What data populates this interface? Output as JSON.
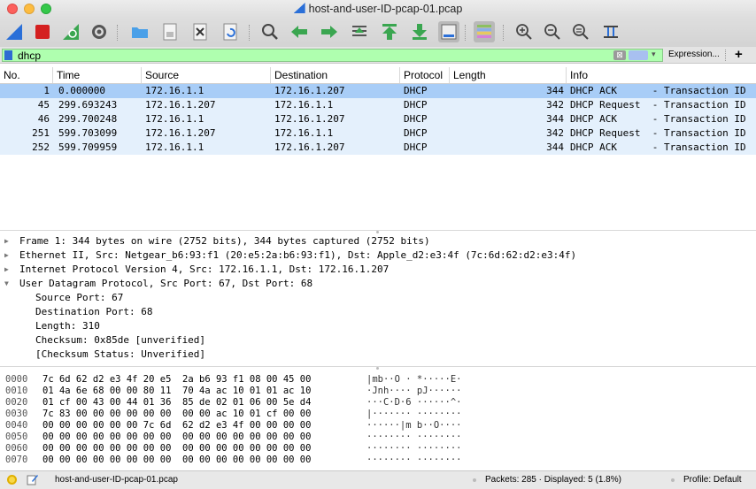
{
  "window": {
    "title": "host-and-user-ID-pcap-01.pcap"
  },
  "filter": {
    "value": "dhcp",
    "expression_label": "Expression...",
    "plus_label": "+",
    "clear_label": "⊠"
  },
  "columns": [
    "No.",
    "Time",
    "Source",
    "Destination",
    "Protocol",
    "Length",
    "Info"
  ],
  "packets": [
    {
      "no": "1",
      "time": "0.000000",
      "src": "172.16.1.1",
      "dst": "172.16.1.207",
      "proto": "DHCP",
      "len": "344",
      "info": "DHCP ACK      - Transaction ID"
    },
    {
      "no": "45",
      "time": "299.693243",
      "src": "172.16.1.207",
      "dst": "172.16.1.1",
      "proto": "DHCP",
      "len": "342",
      "info": "DHCP Request  - Transaction ID"
    },
    {
      "no": "46",
      "time": "299.700248",
      "src": "172.16.1.1",
      "dst": "172.16.1.207",
      "proto": "DHCP",
      "len": "344",
      "info": "DHCP ACK      - Transaction ID"
    },
    {
      "no": "251",
      "time": "599.703099",
      "src": "172.16.1.207",
      "dst": "172.16.1.1",
      "proto": "DHCP",
      "len": "342",
      "info": "DHCP Request  - Transaction ID"
    },
    {
      "no": "252",
      "time": "599.709959",
      "src": "172.16.1.1",
      "dst": "172.16.1.207",
      "proto": "DHCP",
      "len": "344",
      "info": "DHCP ACK      - Transaction ID"
    }
  ],
  "details": [
    {
      "text": "Frame 1: 344 bytes on wire (2752 bits), 344 bytes captured (2752 bits)",
      "expanded": false
    },
    {
      "text": "Ethernet II, Src: Netgear_b6:93:f1 (20:e5:2a:b6:93:f1), Dst: Apple_d2:e3:4f (7c:6d:62:d2:e3:4f)",
      "expanded": false
    },
    {
      "text": "Internet Protocol Version 4, Src: 172.16.1.1, Dst: 172.16.1.207",
      "expanded": false
    },
    {
      "text": "User Datagram Protocol, Src Port: 67, Dst Port: 68",
      "expanded": true
    },
    {
      "text": "Source Port: 67",
      "child": true
    },
    {
      "text": "Destination Port: 68",
      "child": true
    },
    {
      "text": "Length: 310",
      "child": true
    },
    {
      "text": "Checksum: 0x85de [unverified]",
      "child": true
    },
    {
      "text": "[Checksum Status: Unverified]",
      "child": true
    }
  ],
  "hex": [
    {
      "off": "0000",
      "bytes": "7c 6d 62 d2 e3 4f 20 e5  2a b6 93 f1 08 00 45 00",
      "ascii": "|mb··O · *·····E·"
    },
    {
      "off": "0010",
      "bytes": "01 4a 6e 68 00 00 80 11  70 4a ac 10 01 01 ac 10",
      "ascii": "·Jnh···· pJ······"
    },
    {
      "off": "0020",
      "bytes": "01 cf 00 43 00 44 01 36  85 de 02 01 06 00 5e d4",
      "ascii": "···C·D·6 ······^·"
    },
    {
      "off": "0030",
      "bytes": "7c 83 00 00 00 00 00 00  00 00 ac 10 01 cf 00 00",
      "ascii": "|······· ········"
    },
    {
      "off": "0040",
      "bytes": "00 00 00 00 00 00 7c 6d  62 d2 e3 4f 00 00 00 00",
      "ascii": "······|m b··O····"
    },
    {
      "off": "0050",
      "bytes": "00 00 00 00 00 00 00 00  00 00 00 00 00 00 00 00",
      "ascii": "········ ········"
    },
    {
      "off": "0060",
      "bytes": "00 00 00 00 00 00 00 00  00 00 00 00 00 00 00 00",
      "ascii": "········ ········"
    },
    {
      "off": "0070",
      "bytes": "00 00 00 00 00 00 00 00  00 00 00 00 00 00 00 00",
      "ascii": "········ ········"
    }
  ],
  "status": {
    "file": "host-and-user-ID-pcap-01.pcap",
    "packets": "Packets: 285 · Displayed: 5 (1.8%)",
    "profile": "Profile: Default"
  },
  "colors": {
    "selected_row": "#a8cdf7",
    "udp_row": "#e4f0fc",
    "filter_valid": "#afffaf",
    "accent": "#2a6fd8"
  },
  "icons": [
    "shark-fin-start-icon",
    "stop-icon",
    "restart-icon",
    "options-gear-icon",
    "open-folder-icon",
    "save-file-icon",
    "close-file-icon",
    "reload-icon",
    "find-icon",
    "back-arrow-icon",
    "forward-arrow-icon",
    "go-to-packet-icon",
    "first-packet-icon",
    "last-packet-icon",
    "autoscroll-icon",
    "colorize-icon",
    "zoom-in-icon",
    "zoom-out-icon",
    "normal-size-icon",
    "resize-columns-icon"
  ]
}
